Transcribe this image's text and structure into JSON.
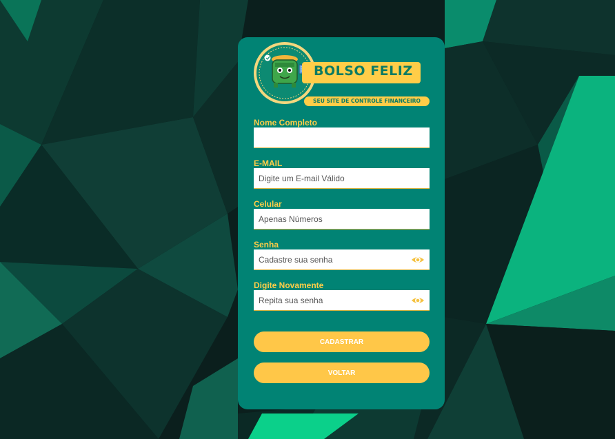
{
  "brand": {
    "name": "BOLSO FELIZ",
    "tagline": "SEU SITE DE CONTROLE FINANCEIRO",
    "mascot_icon": "wallet-mascot-icon"
  },
  "form": {
    "fields": [
      {
        "label": "Nome Completo",
        "value": "",
        "placeholder": ""
      },
      {
        "label": "E-MAIL",
        "value": "",
        "placeholder": "Digite um E-mail Válido"
      },
      {
        "label": "Celular",
        "value": "",
        "placeholder": "Apenas Números"
      },
      {
        "label": "Senha",
        "value": "",
        "placeholder": "Cadastre sua senha",
        "icon": "eye-icon"
      },
      {
        "label": "Digite Novamente",
        "value": "",
        "placeholder": "Repita sua senha",
        "icon": "eye-icon"
      }
    ],
    "submit_label": "CADASTRAR",
    "back_label": "VOLTAR"
  },
  "colors": {
    "card": "#018374",
    "accent": "#ffcd48",
    "button": "#ffc748",
    "brand_text": "#0c7b63"
  }
}
